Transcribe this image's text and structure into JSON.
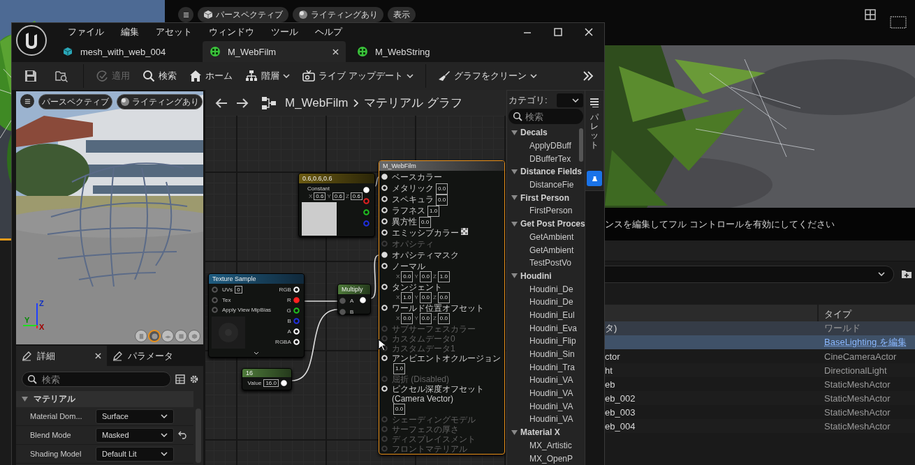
{
  "background": {
    "viewport_toolbar": [
      {
        "kind": "view",
        "label": "パースペクティブ"
      },
      {
        "kind": "lighting",
        "label": "ライティングあり"
      },
      {
        "kind": "show",
        "label": "表示"
      }
    ],
    "message": "ンスを編集してフル コントロールを有効にしてください",
    "outliner": {
      "type_header": "タイプ",
      "rows": [
        {
          "name": "タ)",
          "type": "ワールド",
          "kind": "text",
          "selected": false,
          "highlighted": true
        },
        {
          "type": "BaseLighting を編集",
          "kind": "link",
          "selected": true,
          "highlighted": false
        },
        {
          "name": "ctor",
          "type": "CineCameraActor",
          "kind": "text",
          "selected": false,
          "highlighted": false
        },
        {
          "name": "ht",
          "type": "DirectionalLight",
          "kind": "text",
          "selected": false,
          "highlighted": false
        },
        {
          "name": "eb",
          "type": "StaticMeshActor",
          "kind": "text",
          "selected": false,
          "highlighted": false
        },
        {
          "name": "eb_002",
          "type": "StaticMeshActor",
          "kind": "text",
          "selected": false,
          "highlighted": false
        },
        {
          "name": "eb_003",
          "type": "StaticMeshActor",
          "kind": "text",
          "selected": false,
          "highlighted": false
        },
        {
          "name": "eb_004",
          "type": "StaticMeshActor",
          "kind": "text",
          "selected": false,
          "highlighted": false
        }
      ]
    }
  },
  "window": {
    "menu": [
      "ファイル",
      "編集",
      "アセット",
      "ウィンドウ",
      "ツール",
      "ヘルプ"
    ],
    "tabs": [
      {
        "label": "mesh_with_web_004",
        "kind": "mesh",
        "selected": false
      },
      {
        "label": "M_WebFilm",
        "kind": "material",
        "selected": true
      },
      {
        "label": "M_WebString",
        "kind": "material",
        "selected": false
      }
    ],
    "toolbar": [
      {
        "kind": "apply",
        "label": "適用",
        "disabled": true,
        "menu": false
      },
      {
        "kind": "search",
        "label": "検索",
        "disabled": false,
        "menu": false
      },
      {
        "kind": "home",
        "label": "ホーム",
        "disabled": false,
        "menu": false
      },
      {
        "kind": "hierarchy",
        "label": "階層",
        "disabled": false,
        "menu": true
      },
      {
        "kind": "live",
        "label": "ライブ アップデート",
        "disabled": false,
        "menu": true
      },
      {
        "kind": "clean",
        "label": "グラフをクリーン",
        "disabled": false,
        "menu": true
      }
    ]
  },
  "preview": {
    "view_mode": "パースペクティブ",
    "lighting": "ライティングあり",
    "axis_labels": {
      "z": "Z",
      "y": "Y",
      "x": "X"
    },
    "shapes": [
      {
        "kind": "cylinder",
        "selected": false
      },
      {
        "kind": "sphere",
        "selected": true
      },
      {
        "kind": "plane",
        "selected": false
      },
      {
        "kind": "cube",
        "selected": false
      },
      {
        "kind": "mesh",
        "selected": false
      }
    ]
  },
  "details": {
    "tabs": [
      {
        "label": "詳細",
        "selected": true
      },
      {
        "label": "パラメータ",
        "selected": false
      }
    ],
    "search_placeholder": "検索",
    "category": {
      "label": "マテリアル",
      "expanded": true
    },
    "properties": [
      {
        "label": "Material Dom...",
        "value": "Surface",
        "modified": false
      },
      {
        "label": "Blend Mode",
        "value": "Masked",
        "modified": true
      },
      {
        "label": "Shading Model",
        "value": "Default Lit",
        "modified": false
      }
    ]
  },
  "graph": {
    "breadcrumb": {
      "asset": "M_WebFilm",
      "graph": "マテリアル グラフ"
    },
    "constant": {
      "title": "0.6,0.6,0.6",
      "label": "Constant",
      "fields": [
        {
          "axis": "X",
          "value": "0.6"
        },
        {
          "axis": "Y",
          "value": "0.6"
        },
        {
          "axis": "Z",
          "value": "0.6"
        }
      ],
      "outputs": [
        {
          "color": "#ffffff",
          "connected": true
        },
        {
          "color": "#e02020",
          "connected": false
        },
        {
          "color": "#20c020",
          "connected": false
        },
        {
          "color": "#2030e0",
          "connected": false
        }
      ]
    },
    "texture_sample": {
      "title": "Texture Sample",
      "inputs": [
        {
          "label": "UVs",
          "value": "0"
        },
        {
          "label": "Tex"
        },
        {
          "label": "Apply View MipBias"
        }
      ],
      "outputs": [
        {
          "label": "RGB",
          "color": "#ffffff",
          "connected": false
        },
        {
          "label": "R",
          "color": "#ff2020",
          "connected": true
        },
        {
          "label": "G",
          "color": "#20c020",
          "connected": false
        },
        {
          "label": "B",
          "color": "#2030e0",
          "connected": false
        },
        {
          "label": "A",
          "color": "#ffffff",
          "connected": false
        },
        {
          "label": "RGBA",
          "color": "#ffffff",
          "connected": false
        }
      ]
    },
    "multiply": {
      "title": "Multiply",
      "inputs": [
        "A",
        "B"
      ]
    },
    "scalar": {
      "title": "16",
      "label": "Value",
      "value": "16.0"
    },
    "result": {
      "title": "M_WebFilm",
      "pins": [
        {
          "label": "ベースカラー",
          "kind": "plain",
          "enabled": true,
          "connected": true
        },
        {
          "label": "メタリック",
          "kind": "scalar",
          "value": "0.0",
          "enabled": true,
          "connected": false
        },
        {
          "label": "スペキュラ",
          "kind": "scalar",
          "value": "0.0",
          "enabled": true,
          "connected": false
        },
        {
          "label": "ラフネス",
          "kind": "scalar",
          "value": "1.0",
          "enabled": true,
          "connected": false
        },
        {
          "label": "異方性",
          "kind": "scalar",
          "value": "0.0",
          "enabled": true,
          "connected": false
        },
        {
          "label": "エミッシブカラー",
          "kind": "color",
          "enabled": true,
          "connected": false
        },
        {
          "label": "オパシティ",
          "kind": "plain",
          "enabled": false,
          "connected": false
        },
        {
          "label": "オパシティマスク",
          "kind": "plain",
          "enabled": true,
          "connected": true
        },
        {
          "label": "ノーマル",
          "kind": "vector",
          "values": [
            {
              "axis": "X",
              "value": "0.0"
            },
            {
              "axis": "Y",
              "value": "0.0"
            },
            {
              "axis": "Z",
              "value": "1.0"
            }
          ],
          "enabled": true,
          "connected": false
        },
        {
          "label": "タンジェント",
          "kind": "vector",
          "values": [
            {
              "axis": "X",
              "value": "1.0"
            },
            {
              "axis": "Y",
              "value": "0.0"
            },
            {
              "axis": "Z",
              "value": "0.0"
            }
          ],
          "enabled": true,
          "connected": false
        },
        {
          "label": "ワールド位置オフセット",
          "kind": "vector",
          "values": [
            {
              "axis": "X",
              "value": "0.0"
            },
            {
              "axis": "Y",
              "value": "0.0"
            },
            {
              "axis": "Z",
              "value": "0.0"
            }
          ],
          "enabled": true,
          "connected": false
        },
        {
          "label": "サブサーフェスカラー",
          "kind": "plain",
          "enabled": false,
          "connected": false
        },
        {
          "label": "カスタムデータ0",
          "kind": "plain",
          "enabled": false,
          "connected": false
        },
        {
          "label": "カスタムデータ1",
          "kind": "plain",
          "enabled": false,
          "connected": false
        },
        {
          "label": "アンビエントオクルージョン",
          "kind": "scalar_below",
          "value": "1.0",
          "enabled": true,
          "connected": false
        },
        {
          "label": "屈折 (Disabled)",
          "kind": "plain",
          "enabled": false,
          "connected": false
        },
        {
          "label": "ピクセル深度オフセット (Camera Vector)",
          "kind": "scalar_below",
          "value": "0.0",
          "enabled": true,
          "connected": false
        },
        {
          "label": "シェーディングモデル",
          "kind": "plain",
          "enabled": false,
          "connected": false
        },
        {
          "label": "サーフェスの厚さ",
          "kind": "plain",
          "enabled": false,
          "connected": false
        },
        {
          "label": "ディスプレイスメント",
          "kind": "plain",
          "enabled": false,
          "connected": false
        },
        {
          "label": "フロントマテリアル",
          "kind": "plain",
          "enabled": false,
          "connected": false
        }
      ]
    }
  },
  "palette": {
    "category_label": "カテゴリ:",
    "search_placeholder": "検索",
    "side_tab": "パレット",
    "groups": [
      {
        "label": "Decals",
        "expanded": true,
        "children": [
          {
            "label": "ApplyDBuff"
          },
          {
            "label": "DBufferTex"
          }
        ]
      },
      {
        "label": "Distance Fields",
        "expanded": true,
        "children": [
          {
            "label": "DistanceFie"
          }
        ]
      },
      {
        "label": "First Person",
        "expanded": true,
        "children": [
          {
            "label": "FirstPerson"
          }
        ]
      },
      {
        "label": "Get Post Proces",
        "expanded": true,
        "children": [
          {
            "label": "GetAmbient"
          },
          {
            "label": "GetAmbient"
          },
          {
            "label": "TestPostVo"
          }
        ]
      },
      {
        "label": "Houdini",
        "expanded": true,
        "children": [
          {
            "label": "Houdini_De"
          },
          {
            "label": "Houdini_De"
          },
          {
            "label": "Houdini_Eul"
          },
          {
            "label": "Houdini_Eva"
          },
          {
            "label": "Houdini_Flip"
          },
          {
            "label": "Houdini_Sin"
          },
          {
            "label": "Houdini_Tra"
          },
          {
            "label": "Houdini_VA"
          },
          {
            "label": "Houdini_VA"
          },
          {
            "label": "Houdini_VA"
          },
          {
            "label": "Houdini_VA"
          }
        ]
      },
      {
        "label": "Material X",
        "expanded": true,
        "children": [
          {
            "label": "MX_Artistic"
          },
          {
            "label": "MX_OpenP"
          }
        ]
      }
    ]
  }
}
